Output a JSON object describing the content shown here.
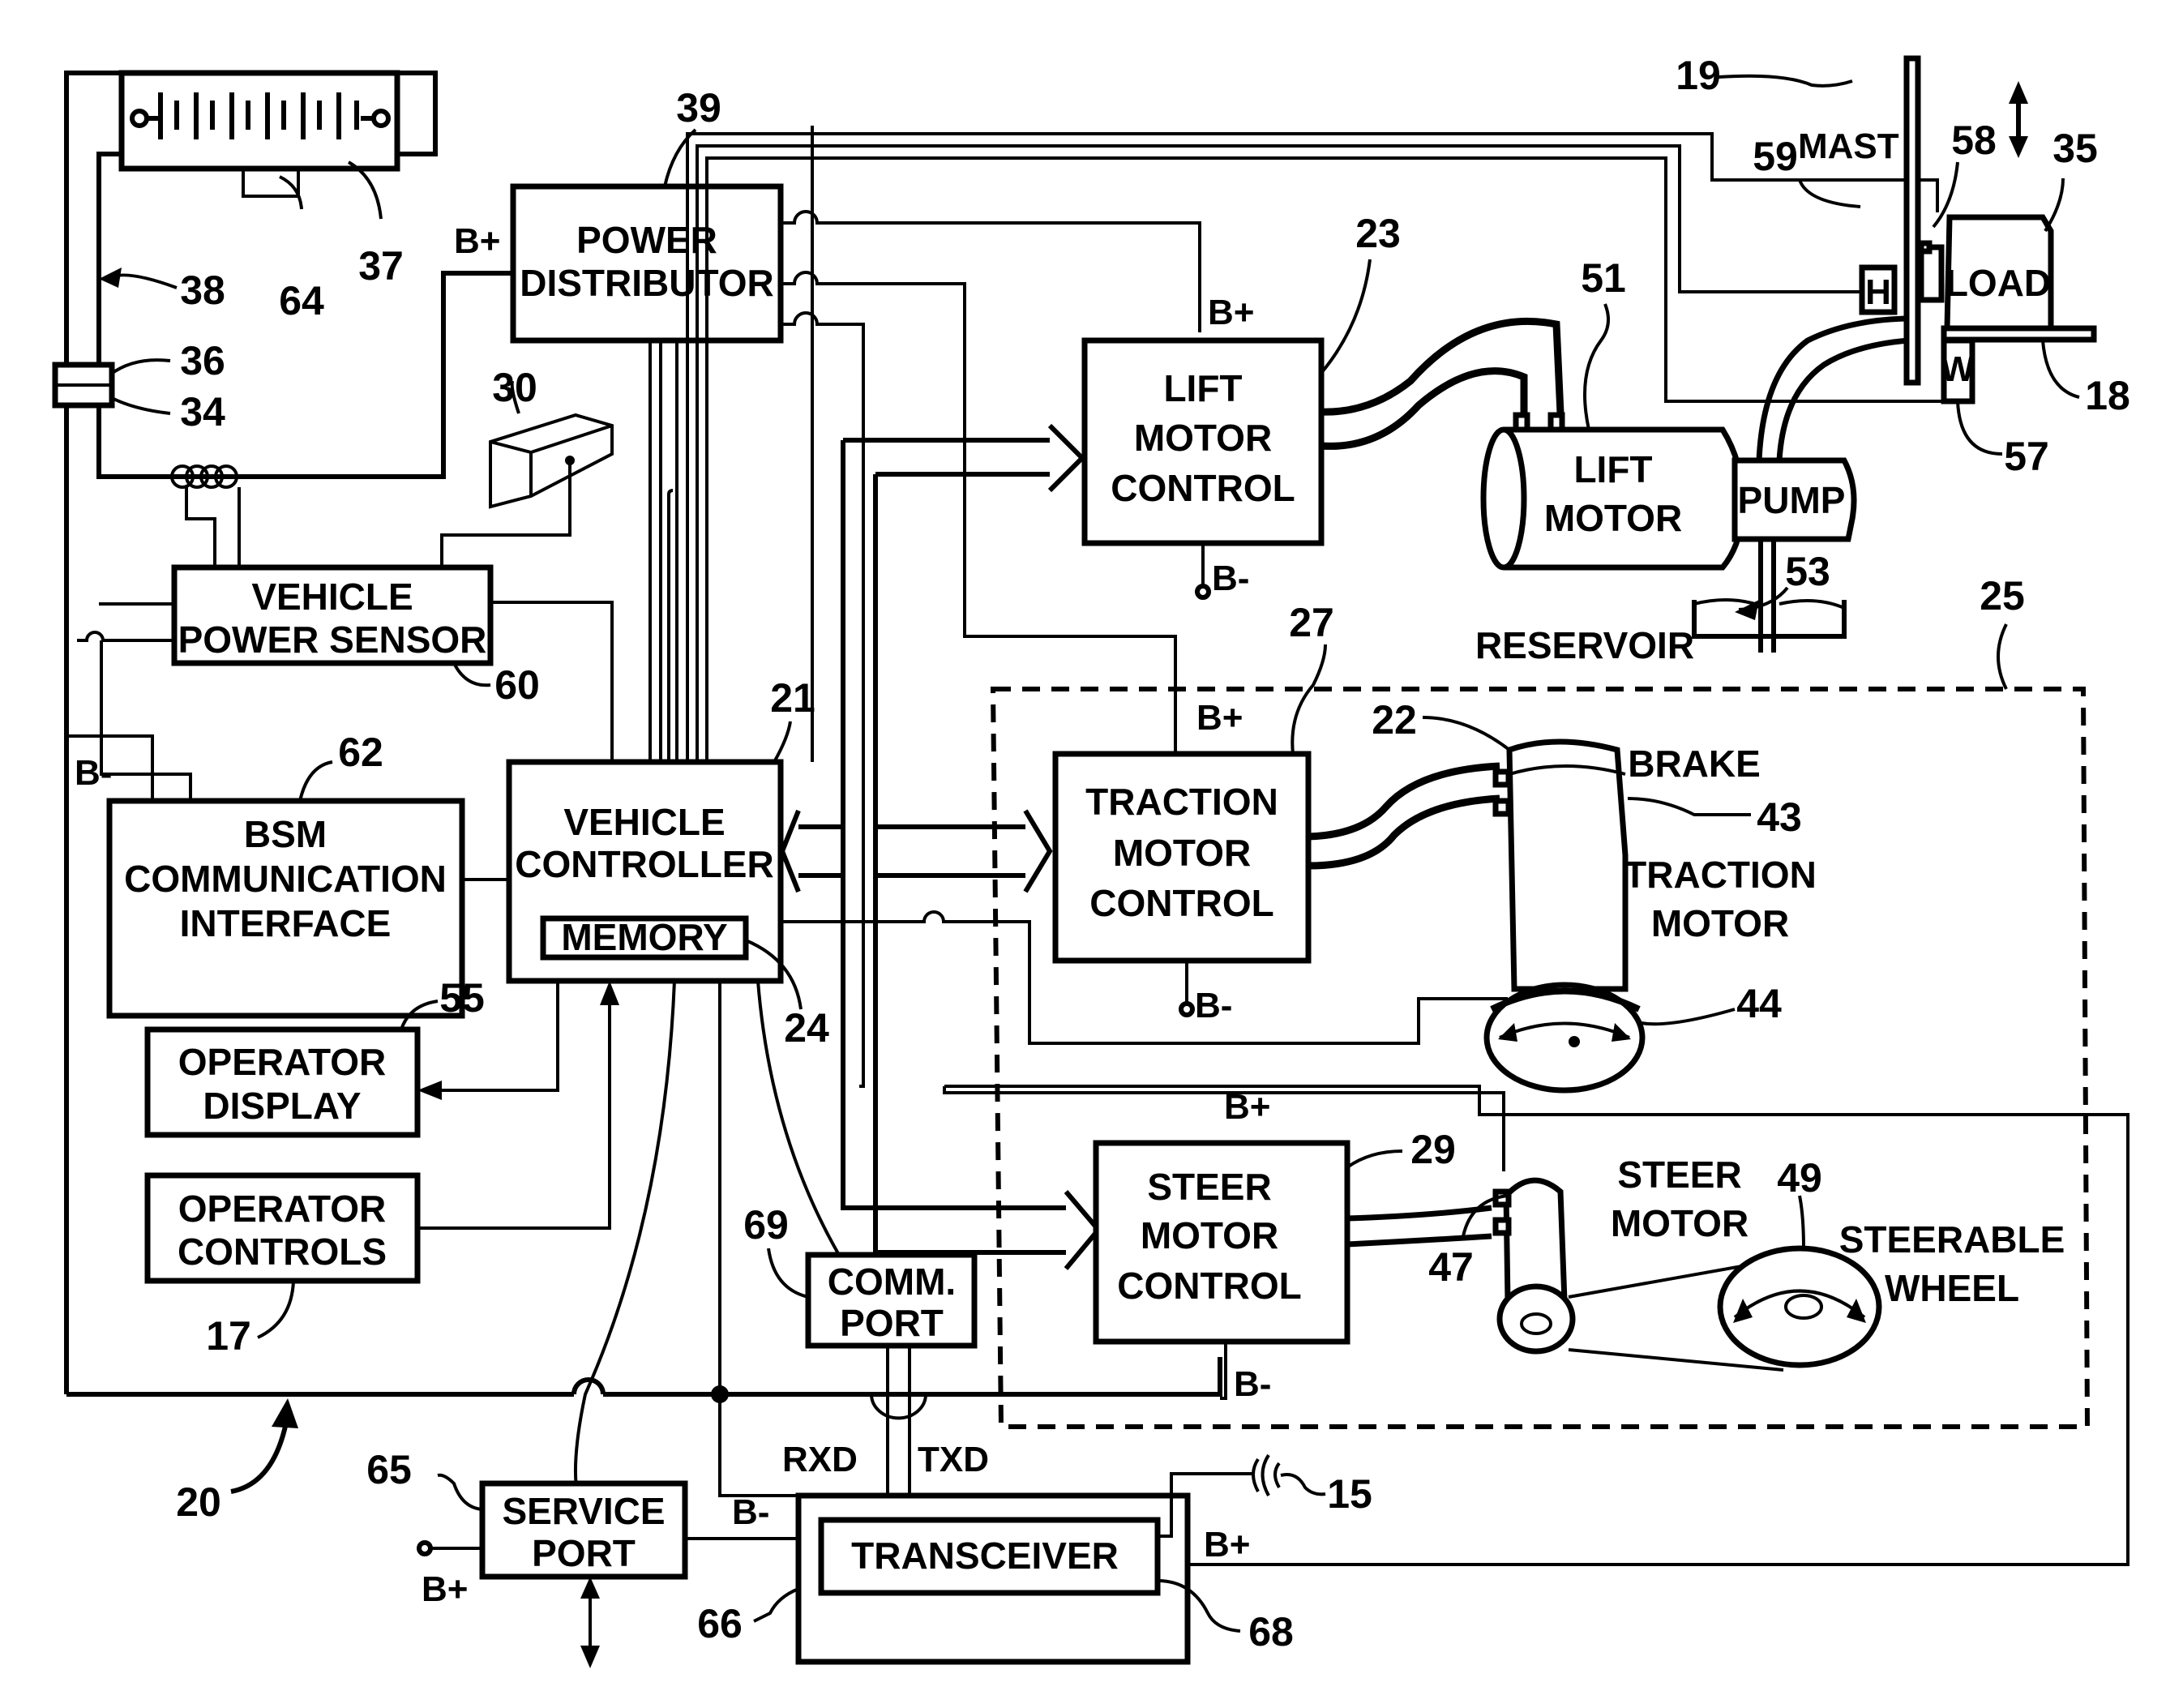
{
  "figure": {
    "overall_ref": "20",
    "blocks": {
      "battery": {
        "ref": "37"
      },
      "battery_sensor": {
        "ref": "64"
      },
      "cable": {
        "ref": "38"
      },
      "connector_upper": {
        "ref": "36"
      },
      "connector_lower": {
        "ref": "34"
      },
      "power_distributor": {
        "line1": "POWER",
        "line2": "DISTRIBUTOR",
        "ref": "39",
        "input_label": "B+"
      },
      "key_switch": {
        "ref": "30"
      },
      "vehicle_power_sensor": {
        "line1": "VEHICLE",
        "line2": "POWER SENSOR",
        "ref": "60"
      },
      "bsm_interface": {
        "line1": "BSM",
        "line2": "COMMUNICATION",
        "line3": "INTERFACE",
        "ref": "62",
        "ground_label": "B-"
      },
      "vehicle_controller": {
        "line1": "VEHICLE",
        "line2": "CONTROLLER",
        "ref": "21"
      },
      "memory": {
        "label": "MEMORY",
        "ref": "24"
      },
      "operator_display": {
        "line1": "OPERATOR",
        "line2": "DISPLAY",
        "ref": "55"
      },
      "operator_controls": {
        "line1": "OPERATOR",
        "line2": "CONTROLS",
        "ref": "17"
      },
      "lift_motor_control": {
        "line1": "LIFT",
        "line2": "MOTOR",
        "line3": "CONTROL",
        "ref": "23",
        "top_label": "B+",
        "bottom_label": "B-"
      },
      "lift_motor": {
        "line1": "LIFT",
        "line2": "MOTOR",
        "ref": "51"
      },
      "pump": {
        "label": "PUMP"
      },
      "hydraulics": {
        "ref": "53"
      },
      "reservoir": {
        "label": "RESERVOIR"
      },
      "mast": {
        "label": "MAST",
        "ref": "19"
      },
      "height_sensor": {
        "label": "H",
        "ref": "59"
      },
      "load_sensor": {
        "ref": "58"
      },
      "load": {
        "label": "LOAD",
        "ref": "35"
      },
      "weight_sensor": {
        "label": "W",
        "ref": "57"
      },
      "forks": {
        "ref": "18"
      },
      "traction_system": {
        "ref": "25"
      },
      "traction_motor_control": {
        "line1": "TRACTION",
        "line2": "MOTOR",
        "line3": "CONTROL",
        "ref": "27",
        "top_label": "B+",
        "bottom_label": "B-"
      },
      "brake": {
        "label": "BRAKE",
        "ref": "22"
      },
      "traction_motor": {
        "line1": "TRACTION",
        "line2": "MOTOR",
        "ref": "43"
      },
      "drive_wheel": {
        "ref": "44"
      },
      "steer_motor_control": {
        "line1": "STEER",
        "line2": "MOTOR",
        "line3": "CONTROL",
        "ref": "29",
        "top_label": "B+",
        "bottom_label": "B-"
      },
      "steer_motor": {
        "line1": "STEER",
        "line2": "MOTOR",
        "ref": "47"
      },
      "steerable_wheel": {
        "line1": "STEERABLE",
        "line2": "WHEEL",
        "ref": "49"
      },
      "comm_port": {
        "line1": "COMM.",
        "line2": "PORT",
        "ref": "69",
        "rx_label": "RXD",
        "tx_label": "TXD"
      },
      "service_port": {
        "line1": "SERVICE",
        "line2": "PORT",
        "ref": "65",
        "supply_label": "B+"
      },
      "transceiver_housing": {
        "ref": "66",
        "ground_label": "B-",
        "supply_label": "B+"
      },
      "transceiver": {
        "label": "TRANSCEIVER",
        "ref": "68"
      },
      "antenna": {
        "ref": "15"
      }
    }
  }
}
